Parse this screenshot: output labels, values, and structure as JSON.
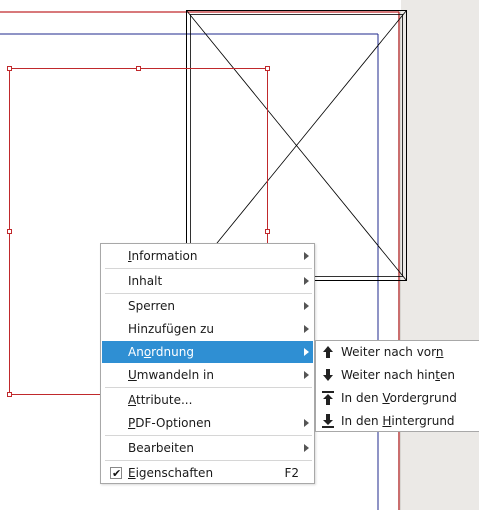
{
  "canvas": {
    "frame_color": "#c0292c",
    "margin_color": "#1f2a8c",
    "image_frame_color": "#000000",
    "pasteboard_color": "#ebe9e6"
  },
  "context_menu": {
    "items": [
      {
        "label": "Information",
        "mnemonic": "I",
        "submenu": true
      },
      {
        "label": "Inhalt",
        "submenu": true
      },
      {
        "label": "Sperren",
        "submenu": true
      },
      {
        "label": "Hinzufügen zu",
        "submenu": true
      },
      {
        "label": "Anordnung",
        "mnemonic": "o",
        "submenu": true,
        "highlighted": true
      },
      {
        "label": "Umwandeln in",
        "mnemonic": "U",
        "submenu": true
      },
      {
        "label": "Attribute...",
        "mnemonic": "A"
      },
      {
        "label": "PDF-Optionen",
        "mnemonic": "P",
        "submenu": true
      },
      {
        "label": "Bearbeiten",
        "submenu": true
      },
      {
        "label": "Eigenschaften",
        "mnemonic": "E",
        "shortcut": "F2",
        "checked": true
      }
    ],
    "highlight_color": "#2f8fd3"
  },
  "arrange_submenu": {
    "items": [
      {
        "label": "Weiter nach vorn",
        "mnemonic": "n",
        "icon": "arrow-up-icon"
      },
      {
        "label": "Weiter nach hinten",
        "mnemonic": "t",
        "icon": "arrow-down-icon"
      },
      {
        "label": "In den Vordergrund",
        "mnemonic": "V",
        "icon": "bring-to-front-icon"
      },
      {
        "label": "In den Hintergrund",
        "mnemonic": "H",
        "icon": "send-to-back-icon"
      }
    ]
  }
}
